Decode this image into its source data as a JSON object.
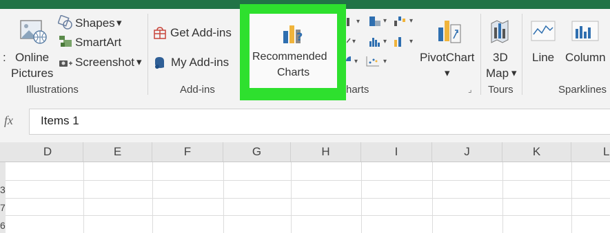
{
  "ribbon": {
    "illustrations": {
      "online_pictures_line1": "Online",
      "online_pictures_line2": "Pictures",
      "shapes": "Shapes",
      "smartart": "SmartArt",
      "screenshot": "Screenshot",
      "group_label": "Illustrations"
    },
    "addins": {
      "get_addins": "Get Add-ins",
      "my_addins": "My Add-ins",
      "group_label": "Add-ins"
    },
    "charts": {
      "recommended_line1": "Recommended",
      "recommended_line2": "Charts",
      "pivotchart": "PivotChart",
      "group_label": "harts"
    },
    "tours": {
      "map3d_line1": "3D",
      "map3d_line2": "Map",
      "group_label": "Tours"
    },
    "sparklines": {
      "line": "Line",
      "column": "Column",
      "group_label": "Sparklines"
    }
  },
  "formula_bar": {
    "fx": "fx",
    "value": "Items 1"
  },
  "columns": [
    "D",
    "E",
    "F",
    "G",
    "H",
    "I",
    "J",
    "K",
    "L"
  ],
  "rows": [
    "3",
    "7",
    "6"
  ],
  "colors": {
    "highlight": "#2ee02e",
    "title_bar": "#217346"
  }
}
